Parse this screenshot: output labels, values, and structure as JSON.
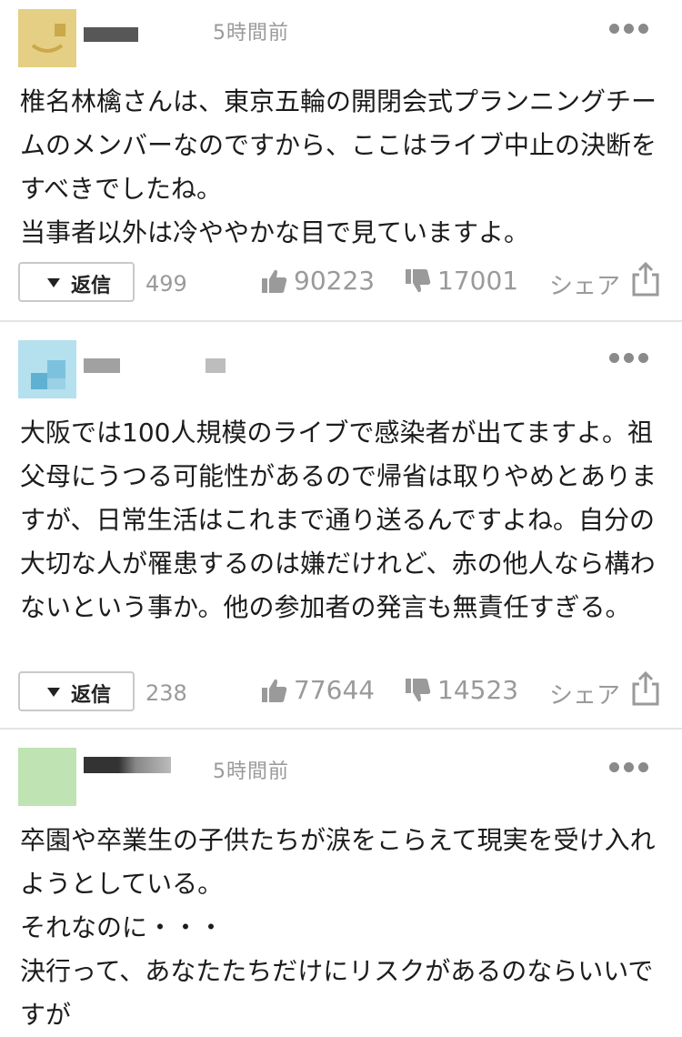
{
  "reply_label": "返信",
  "share_label": "シェア",
  "comments": [
    {
      "time": "5時間前",
      "text": "椎名林檎さんは、東京五輪の開閉会式プランニングチームのメンバーなのですから、ここはライブ中止の決断をすべきでしたね。\n当事者以外は冷ややかな目で見ていますよ。",
      "reply_count": "499",
      "likes": "90223",
      "dislikes": "17001"
    },
    {
      "time": "",
      "text": "大阪では100人規模のライブで感染者が出てますよ。祖父母にうつる可能性があるので帰省は取りやめとありますが、日常生活はこれまで通り送るんですよね。自分の大切な人が罹患するのは嫌だけれど、赤の他人なら構わないという事か。他の参加者の発言も無責任すぎる。",
      "reply_count": "238",
      "likes": "77644",
      "dislikes": "14523"
    },
    {
      "time": "5時間前",
      "text": "卒園や卒業生の子供たちが涙をこらえて現実を受け入れようとしている。\nそれなのに・・・\n決行って、あなたたちだけにリスクがあるのならいいですが",
      "reply_count": "",
      "likes": "",
      "dislikes": ""
    }
  ]
}
